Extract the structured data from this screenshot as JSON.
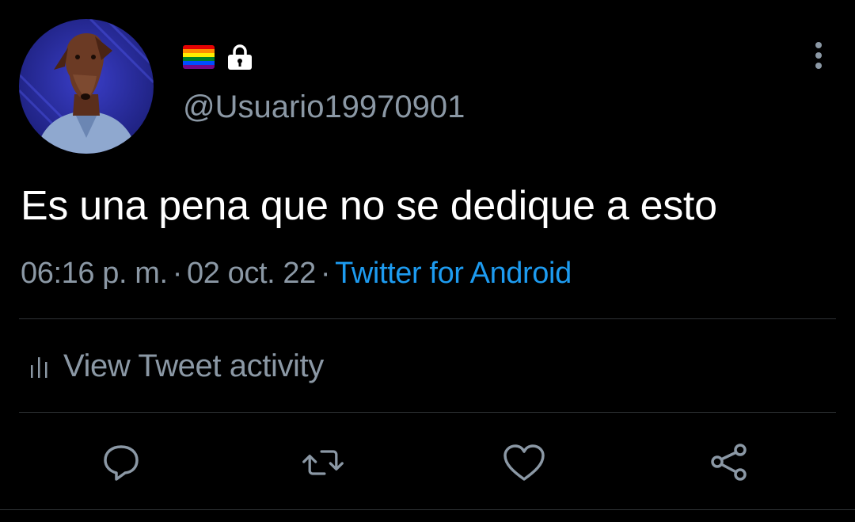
{
  "author": {
    "handle": "@Usuario19970901",
    "badges": [
      "rainbow-flag-icon",
      "lock-icon"
    ]
  },
  "tweet": {
    "text": "Es una pena que no se dedique a esto",
    "time": "06:16 p. m.",
    "separator": "·",
    "date": "02 oct. 22",
    "source": "Twitter for Android"
  },
  "activity": {
    "label": "View Tweet activity"
  },
  "actions": [
    "reply-icon",
    "retweet-icon",
    "like-icon",
    "share-icon"
  ],
  "colors": {
    "background": "#000000",
    "text": "#ffffff",
    "secondary_text": "#8b98a5",
    "link": "#1d9bf0",
    "divider": "#2f3336",
    "flag": [
      "#e40303",
      "#ff8c00",
      "#ffed00",
      "#008026",
      "#004dff",
      "#750787"
    ]
  }
}
